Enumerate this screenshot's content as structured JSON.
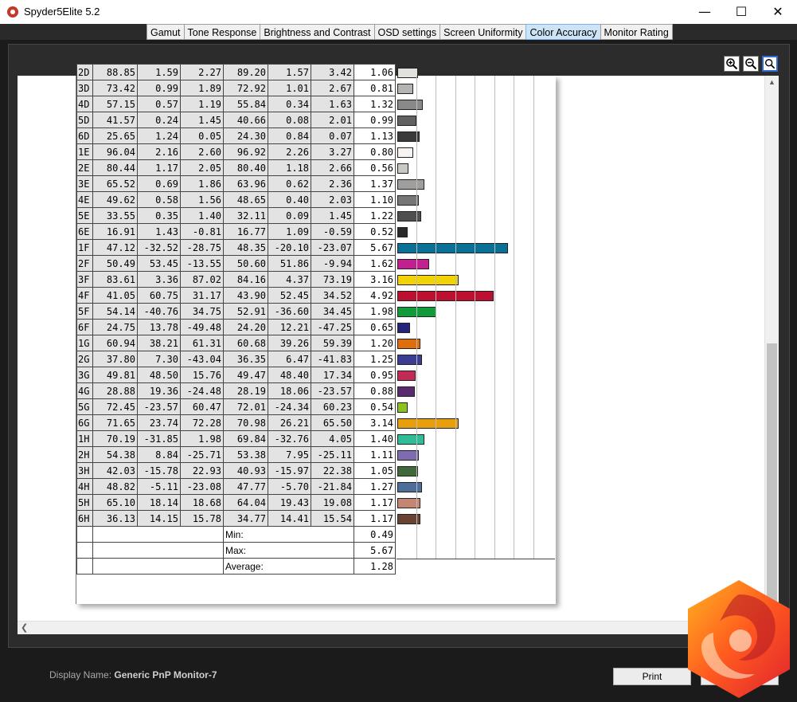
{
  "window": {
    "title": "Spyder5Elite 5.2"
  },
  "tabs": [
    {
      "label": "Gamut",
      "active": false
    },
    {
      "label": "Tone Response",
      "active": false
    },
    {
      "label": "Brightness and Contrast",
      "active": false
    },
    {
      "label": "OSD settings",
      "active": false
    },
    {
      "label": "Screen Uniformity",
      "active": false
    },
    {
      "label": "Color Accuracy",
      "active": true
    },
    {
      "label": "Monitor Rating",
      "active": false
    }
  ],
  "table": {
    "rows": [
      {
        "id": "2D",
        "c": [
          "88.85",
          "1.59",
          "2.27",
          "89.20",
          "1.57",
          "3.42",
          "1.06"
        ],
        "color": "#e3e1de"
      },
      {
        "id": "3D",
        "c": [
          "73.42",
          "0.99",
          "1.89",
          "72.92",
          "1.01",
          "2.67",
          "0.81"
        ],
        "color": "#b6b4b1"
      },
      {
        "id": "4D",
        "c": [
          "57.15",
          "0.57",
          "1.19",
          "55.84",
          "0.34",
          "1.63",
          "1.32"
        ],
        "color": "#8a8988"
      },
      {
        "id": "5D",
        "c": [
          "41.57",
          "0.24",
          "1.45",
          "40.66",
          "0.08",
          "2.01",
          "0.99"
        ],
        "color": "#626160"
      },
      {
        "id": "6D",
        "c": [
          "25.65",
          "1.24",
          "0.05",
          "24.30",
          "0.84",
          "0.07",
          "1.13"
        ],
        "color": "#3b3a3a"
      },
      {
        "id": "1E",
        "c": [
          "96.04",
          "2.16",
          "2.60",
          "96.92",
          "2.26",
          "3.27",
          "0.80"
        ],
        "color": "#f6f3f0"
      },
      {
        "id": "2E",
        "c": [
          "80.44",
          "1.17",
          "2.05",
          "80.40",
          "1.18",
          "2.66",
          "0.56"
        ],
        "color": "#cac8c5"
      },
      {
        "id": "3E",
        "c": [
          "65.52",
          "0.69",
          "1.86",
          "63.96",
          "0.62",
          "2.36",
          "1.37"
        ],
        "color": "#a09e9c"
      },
      {
        "id": "4E",
        "c": [
          "49.62",
          "0.58",
          "1.56",
          "48.65",
          "0.40",
          "2.03",
          "1.10"
        ],
        "color": "#777675"
      },
      {
        "id": "5E",
        "c": [
          "33.55",
          "0.35",
          "1.40",
          "32.11",
          "0.09",
          "1.45",
          "1.22"
        ],
        "color": "#4f4e4d"
      },
      {
        "id": "6E",
        "c": [
          "16.91",
          "1.43",
          "-0.81",
          "16.77",
          "1.09",
          "-0.59",
          "0.52"
        ],
        "color": "#2b2a2a"
      },
      {
        "id": "1F",
        "c": [
          "47.12",
          "-32.52",
          "-28.75",
          "48.35",
          "-20.10",
          "-23.07",
          "5.67"
        ],
        "color": "#0a7196"
      },
      {
        "id": "2F",
        "c": [
          "50.49",
          "53.45",
          "-13.55",
          "50.60",
          "51.86",
          "-9.94",
          "1.62"
        ],
        "color": "#c31f8e"
      },
      {
        "id": "3F",
        "c": [
          "83.61",
          "3.36",
          "87.02",
          "84.16",
          "4.37",
          "73.19",
          "3.16"
        ],
        "color": "#f0d205"
      },
      {
        "id": "4F",
        "c": [
          "41.05",
          "60.75",
          "31.17",
          "43.90",
          "52.45",
          "34.52",
          "4.92"
        ],
        "color": "#bd0f2f"
      },
      {
        "id": "5F",
        "c": [
          "54.14",
          "-40.76",
          "34.75",
          "52.91",
          "-36.60",
          "34.45",
          "1.98"
        ],
        "color": "#119b3a"
      },
      {
        "id": "6F",
        "c": [
          "24.75",
          "13.78",
          "-49.48",
          "24.20",
          "12.21",
          "-47.25",
          "0.65"
        ],
        "color": "#23247a"
      },
      {
        "id": "1G",
        "c": [
          "60.94",
          "38.21",
          "61.31",
          "60.68",
          "39.26",
          "59.39",
          "1.20"
        ],
        "color": "#de6d0c"
      },
      {
        "id": "2G",
        "c": [
          "37.80",
          "7.30",
          "-43.04",
          "36.35",
          "6.47",
          "-41.83",
          "1.25"
        ],
        "color": "#3a3d92"
      },
      {
        "id": "3G",
        "c": [
          "49.81",
          "48.50",
          "15.76",
          "49.47",
          "48.40",
          "17.34",
          "0.95"
        ],
        "color": "#c32a55"
      },
      {
        "id": "4G",
        "c": [
          "28.88",
          "19.36",
          "-24.48",
          "28.19",
          "18.06",
          "-23.57",
          "0.88"
        ],
        "color": "#5a2a6e"
      },
      {
        "id": "5G",
        "c": [
          "72.45",
          "-23.57",
          "60.47",
          "72.01",
          "-24.34",
          "60.23",
          "0.54"
        ],
        "color": "#8cc31f"
      },
      {
        "id": "6G",
        "c": [
          "71.65",
          "23.74",
          "72.28",
          "70.98",
          "26.21",
          "65.50",
          "3.14"
        ],
        "color": "#e79f0b"
      },
      {
        "id": "1H",
        "c": [
          "70.19",
          "-31.85",
          "1.98",
          "69.84",
          "-32.76",
          "4.05",
          "1.40"
        ],
        "color": "#2fbd97"
      },
      {
        "id": "2H",
        "c": [
          "54.38",
          "8.84",
          "-25.71",
          "53.38",
          "7.95",
          "-25.11",
          "1.11"
        ],
        "color": "#7f6bb0"
      },
      {
        "id": "3H",
        "c": [
          "42.03",
          "-15.78",
          "22.93",
          "40.93",
          "-15.97",
          "22.38",
          "1.05"
        ],
        "color": "#41683a"
      },
      {
        "id": "4H",
        "c": [
          "48.82",
          "-5.11",
          "-23.08",
          "47.77",
          "-5.70",
          "-21.84",
          "1.27"
        ],
        "color": "#4c6e98"
      },
      {
        "id": "5H",
        "c": [
          "65.10",
          "18.14",
          "18.68",
          "64.04",
          "19.43",
          "19.08",
          "1.17"
        ],
        "color": "#c48672"
      },
      {
        "id": "6H",
        "c": [
          "36.13",
          "14.15",
          "15.78",
          "34.77",
          "14.41",
          "15.54",
          "1.17"
        ],
        "color": "#684233"
      }
    ],
    "summary": [
      {
        "label": "Min:",
        "value": "0.49"
      },
      {
        "label": "Max:",
        "value": "5.67"
      },
      {
        "label": "Average:",
        "value": "1.28"
      }
    ]
  },
  "chart_data": {
    "type": "bar",
    "orientation": "horizontal",
    "categories": [
      "2D",
      "3D",
      "4D",
      "5D",
      "6D",
      "1E",
      "2E",
      "3E",
      "4E",
      "5E",
      "6E",
      "1F",
      "2F",
      "3F",
      "4F",
      "5F",
      "6F",
      "1G",
      "2G",
      "3G",
      "4G",
      "5G",
      "6G",
      "1H",
      "2H",
      "3H",
      "4H",
      "5H",
      "6H"
    ],
    "values": [
      1.06,
      0.81,
      1.32,
      0.99,
      1.13,
      0.8,
      0.56,
      1.37,
      1.1,
      1.22,
      0.52,
      5.67,
      1.62,
      3.16,
      4.92,
      1.98,
      0.65,
      1.2,
      1.25,
      0.95,
      0.88,
      0.54,
      3.14,
      1.4,
      1.11,
      1.05,
      1.27,
      1.17,
      1.17
    ],
    "xlim": [
      0,
      8
    ],
    "grid": true
  },
  "footer": {
    "display_label": "Display Name:",
    "display_value": "Generic PnP Monitor-7",
    "print_label": "Print"
  }
}
